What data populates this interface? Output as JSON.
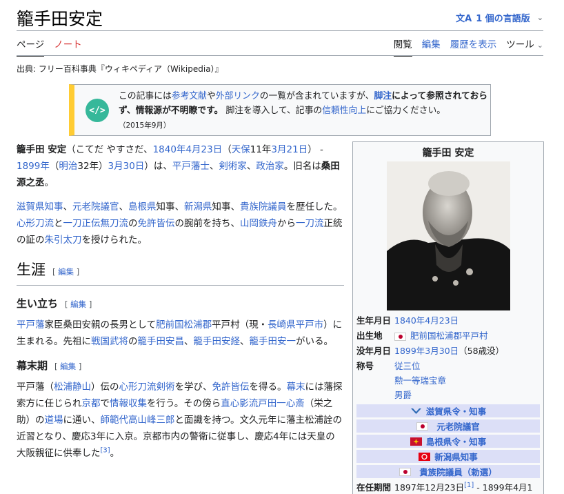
{
  "page": {
    "title": "籠手田安定",
    "lang_label": "1 個の言語版",
    "tabs_left": [
      "ページ",
      "ノート"
    ],
    "tabs_right": [
      "閲覧",
      "編集",
      "履歴を表示",
      "ツール"
    ],
    "source": "出典: フリー百科事典『ウィキペディア（Wikipedia）』"
  },
  "ambox": {
    "t1": "この記事には",
    "l1": "参考文献",
    "t2": "や",
    "l2": "外部リンク",
    "t3": "の一覧が含まれていますが、",
    "l3": "脚注",
    "b1": "によって参照されておらず、情報源が不明瞭です。",
    "t4": " 脚注を導入して、記事の",
    "l4": "信頼性向上",
    "t5": "にご協力ください。",
    "date": "（2015年9月）"
  },
  "lead": {
    "p1": {
      "name": "籠手田 安定",
      "reading": "（こてだ やすさだ、",
      "l_birth": "1840年",
      "l_birth_day": "4月23日",
      "t_tenpo": "（",
      "l_tenpo": "天保",
      "t_tenpo2": "11年",
      "l_tenpo_day": "3月21日",
      "t_dash": "） - ",
      "l_death": "1899年",
      "t_meiji": "（",
      "l_meiji": "明治",
      "t_meiji2": "32年）",
      "l_death_day": "3月30日",
      "t_wa": "）は、",
      "l_hirado": "平戸藩士",
      "t_c1": "、",
      "l_kenjutsu": "剣術家",
      "t_c2": "、",
      "l_seiji": "政治家",
      "t_kyu": "。旧名は",
      "b_kyu": "桑田源之丞",
      "t_end": "。"
    },
    "p2": {
      "l_shiga": "滋賀県知事",
      "t1": "、",
      "l_genro": "元老院議官",
      "t2": "、",
      "l_shimane": "島根県",
      "t3": "知事、",
      "l_niigata": "新潟県",
      "t4": "知事、",
      "l_kizoku": "貴族院議員",
      "t5": "を歴任した。",
      "l_shingyo": "心形刀流",
      "t6": "と",
      "l_itto": "一刀正伝無刀流",
      "t7": "の",
      "l_menkyo": "免許皆伝",
      "t8": "の腕前を持ち、",
      "l_yamaoka": "山岡鉄舟",
      "t9": "から",
      "l_ittoryu": "一刀流",
      "t10": "正統の証の",
      "l_shubiki": "朱引太刀",
      "t11": "を授けられた。"
    }
  },
  "sections": {
    "h2": "生涯",
    "edit": "編集",
    "h3a": "生い立ち",
    "p3": {
      "l1": "平戸藩",
      "t1": "家臣桑田安親の長男として",
      "l2": "肥前国",
      "l3": "松浦郡",
      "t2": "平戸村（現・",
      "l4": "長崎県",
      "l5": "平戸市",
      "t3": "）に生まれる。先祖に",
      "l6": "戦国武将",
      "t4": "の",
      "l7": "籠手田安昌",
      "t5": "、",
      "l8": "籠手田安経",
      "t6": "、",
      "l9": "籠手田安一",
      "t7": "がいる。"
    },
    "h3b": "幕末期",
    "p4": {
      "t1": "平戸藩（",
      "l1": "松浦静山",
      "t2": "）伝の",
      "l2": "心形刀流",
      "l3": "剣術",
      "t3": "を学び、",
      "l4": "免許皆伝",
      "t4": "を得る。",
      "l5": "幕末",
      "t5": "には藩探索方に任じられ",
      "l6": "京都",
      "t6": "で",
      "l7": "情報収集",
      "t7": "を行う。その傍ら",
      "l8": "直心影流",
      "l9": "戸田一心斎",
      "t8": "（栄之助）の",
      "l10": "道場",
      "t9": "に通い、",
      "l11": "師範代",
      "l12": "高山峰三郎",
      "t10": "と面識を持つ。文久元年に藩主松浦詮の近習となり、慶応3年に入京。京都市内の警衛に従事し、慶応4年には天皇の大阪親征に供奉した",
      "ref": "[3]",
      "t11": "。"
    }
  },
  "infobox": {
    "name": "籠手田 安定",
    "birth_label": "生年月日",
    "birth_val": "1840年4月23日",
    "place_label": "出生地",
    "place_val": "肥前国松浦郡平戸村",
    "death_label": "没年月日",
    "death_date": "1899年3月30日",
    "death_age": "（58歳没）",
    "titles_label": "称号",
    "titles": [
      "従三位",
      "勲一等瑞宝章",
      "男爵"
    ],
    "bands": [
      "滋賀県令・知事",
      "元老院議官",
      "島根県令・知事",
      "新潟県知事",
      "貴族院議員（勅選）"
    ],
    "term_label": "在任期間",
    "term_val": "1897年12月23日",
    "term_ref": "[1]",
    "term_end": " - 1899年4月1"
  },
  "colors": {
    "link": "#3366cc",
    "new_link": "#d73333",
    "ambox_bar": "#ffcc33",
    "band_bg": "#dcdff7"
  }
}
